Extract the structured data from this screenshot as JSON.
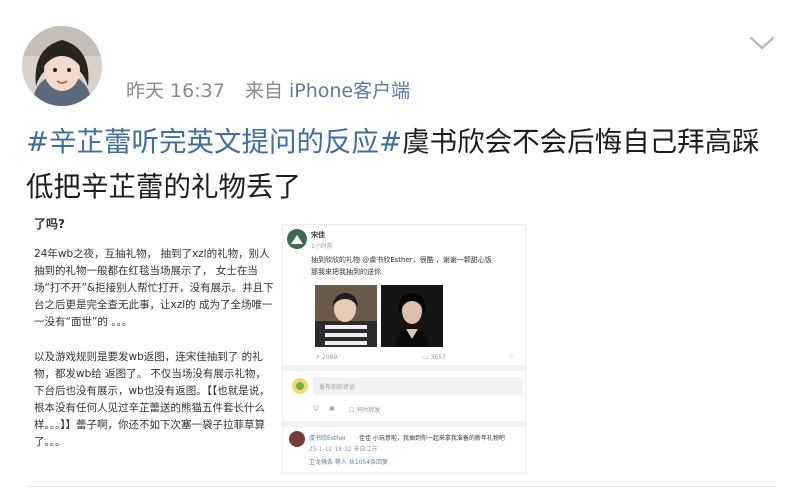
{
  "header": {
    "time": "昨天 16:37",
    "source_prefix": "来自",
    "source": "iPhone客户端",
    "more_icon": "chevron-down-icon"
  },
  "post": {
    "hashtag1": "#辛芷蕾听完英文提问的反应#",
    "text": "虞书欣会不会后悔自己拜高踩低把辛芷蕾的礼物丢了"
  },
  "left_card": {
    "heading": "了吗?",
    "para1": "24年wb之夜，互抽礼物， 抽到了xzl的礼物，别人抽到的礼物一般都在红毯当场展示了， 女士在当场“打不开”&拒接别人帮忙打开，没有展示。并且下台之后更是完全查无此事，让xzl的 成为了全场唯一一没有“面世”的 。。。",
    "para2": "以及游戏规则是要发wb返图，连宋佳抽到了 的礼物，都发wb给 返图了。 不仅当场没有展示礼物，下台后也没有展示，wb也没有返图。【【也就是说，根本没有任何人见过辛芷蕾送的熊猫五件套长什么样。。。】】蕾子啊，你还不如下次塞一袋子拉菲草算了。。。"
  },
  "right_card": {
    "author": "宋佳",
    "author_time": "1小时前",
    "line1": "抽到欣欣的礼物 @虞书欣Esther，很酷 ，谢谢一颗甜心饭",
    "line2": "那我来把我抽到的送你",
    "repost_count": "2089",
    "comment_count": "3657",
    "comment_placeholder": "发布你的评论",
    "repost_label": "同时转发",
    "reply_author": "虞书欣Esther",
    "reply_text": "佳佳 小玩意啦，我抽到你一起来拿我准备的新年礼物吧",
    "reply_meta": "25-1-12 18:32 来自江苏",
    "reply_thread": "卫龙辣条 等人 共1054条回复"
  }
}
